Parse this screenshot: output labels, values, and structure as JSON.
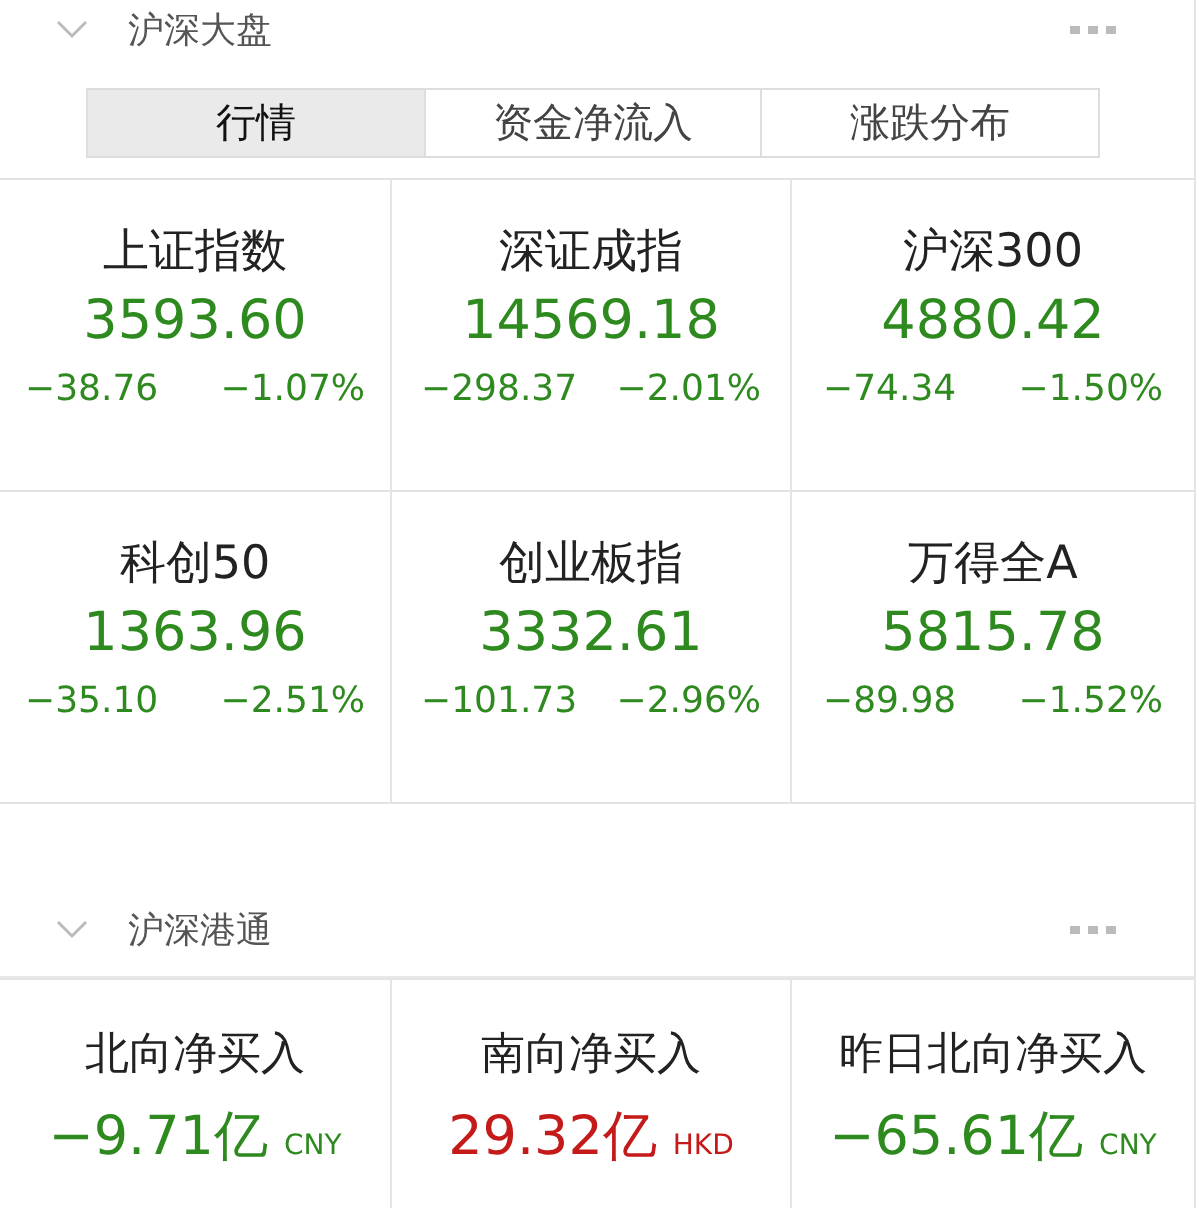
{
  "sections": [
    {
      "title": "沪深大盘",
      "tabs": [
        {
          "label": "行情",
          "selected": true
        },
        {
          "label": "资金净流入",
          "selected": false
        },
        {
          "label": "涨跌分布",
          "selected": false
        }
      ],
      "indices": [
        {
          "name": "上证指数",
          "value": "3593.60",
          "change": "−38.76",
          "percent": "−1.07%",
          "color": "#2e8a1f"
        },
        {
          "name": "深证成指",
          "value": "14569.18",
          "change": "−298.37",
          "percent": "−2.01%",
          "color": "#2e8a1f"
        },
        {
          "name": "沪深300",
          "value": "4880.42",
          "change": "−74.34",
          "percent": "−1.50%",
          "color": "#2e8a1f"
        },
        {
          "name": "科创50",
          "value": "1363.96",
          "change": "−35.10",
          "percent": "−2.51%",
          "color": "#2e8a1f"
        },
        {
          "name": "创业板指",
          "value": "3332.61",
          "change": "−101.73",
          "percent": "−2.96%",
          "color": "#2e8a1f"
        },
        {
          "name": "万得全A",
          "value": "5815.78",
          "change": "−89.98",
          "percent": "−1.52%",
          "color": "#2e8a1f"
        }
      ]
    },
    {
      "title": "沪深港通",
      "flows": [
        {
          "name": "北向净买入",
          "value": "−9.71亿",
          "currency": "CNY",
          "color": "#2e8a1f"
        },
        {
          "name": "南向净买入",
          "value": "29.32亿",
          "currency": "HKD",
          "color": "#c41a1a"
        },
        {
          "name": "昨日北向净买入",
          "value": "−65.61亿",
          "currency": "CNY",
          "color": "#2e8a1f"
        }
      ]
    }
  ]
}
